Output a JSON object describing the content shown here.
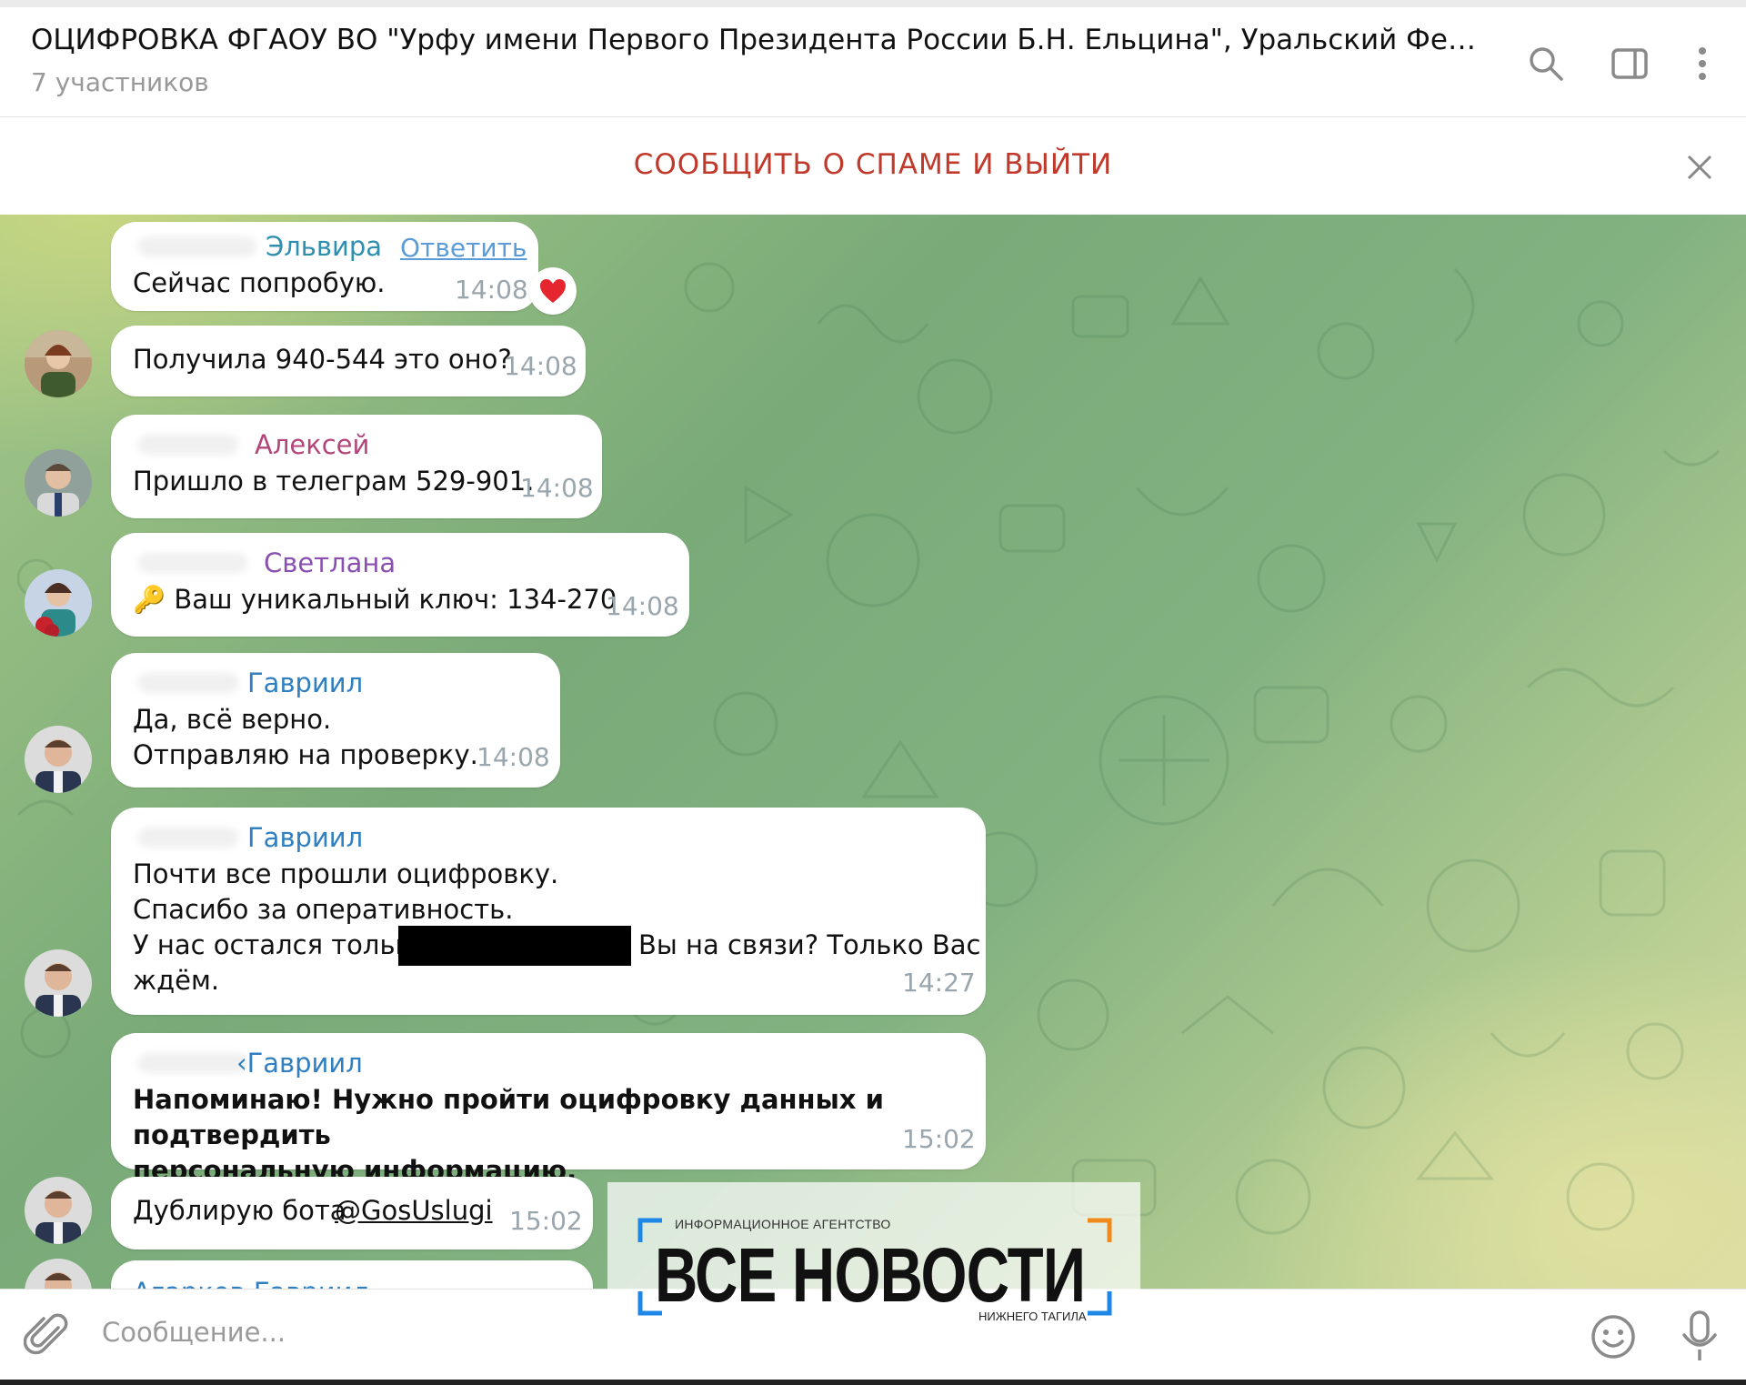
{
  "header": {
    "title": "ОЦИФРОВКА ФГАОУ ВО \"Урфу имени Первого Президента России Б.Н. Ельцина\", Уральский Федеральный Ун...",
    "subtitle": "7 участников",
    "icons": [
      "search-icon",
      "sidebar-toggle-icon",
      "more-vertical-icon"
    ]
  },
  "spam_bar": {
    "label": "СООБЩИТЬ О СПАМЕ И ВЫЙТИ",
    "close_icon": "close-icon"
  },
  "messages": [
    {
      "sender": "Эльвира",
      "text": "Сейчас попробую.",
      "time": "14:08",
      "reply_label": "Ответить",
      "reaction": "heart"
    },
    {
      "sender": "",
      "text": "Получила  940-544 это оно?",
      "time": "14:08"
    },
    {
      "sender": "Алексей",
      "text": "Пришло в телеграм 529-901.",
      "time": "14:08"
    },
    {
      "sender": "Светлана",
      "text": "🔑 Ваш уникальный ключ: 134-270",
      "time": "14:08"
    },
    {
      "sender": "Гавриил",
      "text": "Да, всё верно.\nОтправляю на проверку.",
      "time": "14:08"
    },
    {
      "sender": "Гавриил",
      "line1": "Почти все прошли оцифровку.",
      "line2": "Спасибо за оперативность.",
      "line3a": "У нас остался только",
      "line3b": "Вы на связи? Только Вас",
      "line4": "ждём.",
      "time": "14:27"
    },
    {
      "sender": "‹Гавриил",
      "text": "Напоминаю! Нужно пройти оцифровку данных и подтвердить\nперсональную информацию.",
      "time": "15:02"
    },
    {
      "text_prefix": "Дублирую бота ",
      "mention": "@GosUslugi",
      "time": "15:02"
    },
    {
      "sender": "Агарков Гавриил"
    }
  ],
  "composer": {
    "placeholder": "Сообщение...",
    "icons": [
      "paperclip-icon",
      "emoji-icon",
      "microphone-icon"
    ]
  },
  "watermark": {
    "small": "ИНФОРМАЦИОННОЕ АГЕНТСТВО",
    "big": "ВСЕ НОВОСТИ",
    "city": "НИЖНЕГО ТАГИЛА"
  },
  "colors": {
    "accent_red": "#c0392b",
    "sender_teal": "#2f8fb0",
    "sender_magenta": "#b3457a",
    "sender_purple": "#8a4fb0",
    "sender_blue": "#2f7fc1",
    "time_gray": "#9aa6ad",
    "watermark_orange": "#f08a1d",
    "watermark_blue": "#1d86e6"
  }
}
